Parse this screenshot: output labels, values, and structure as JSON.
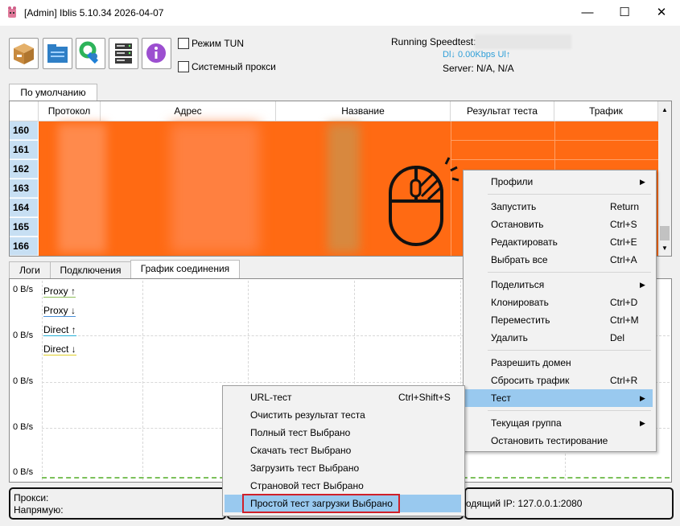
{
  "window": {
    "title": "[Admin] Iblis 5.10.34 2026-04-07",
    "minimize": "—",
    "maximize": "☐",
    "close": "✕"
  },
  "toolbar": {
    "buttons": [
      "box-icon",
      "folder-icon",
      "tools-icon",
      "server-icon",
      "info-icon"
    ],
    "tun_label": "Режим TUN",
    "proxy_label": "Системный прокси"
  },
  "speedtest": {
    "label": "Running Speedtest:",
    "rate": "Dl↓ 0.00Kbps Ul↑",
    "server": "Server: N/A, N/A"
  },
  "group_tab": "По умолчанию",
  "grid": {
    "columns": [
      "Протокол",
      "Адрес",
      "Название",
      "Результат теста",
      "Трафик"
    ],
    "rows": [
      "160",
      "161",
      "162",
      "163",
      "164",
      "165",
      "166"
    ],
    "row_color": "#ff6a13"
  },
  "bottom_tabs": [
    "Логи",
    "Подключения",
    "График соединения"
  ],
  "chart": {
    "y_labels": [
      "0 B/s",
      "0 B/s",
      "0 B/s",
      "0 B/s",
      "0 B/s"
    ],
    "legend": [
      {
        "name": "Proxy ↑",
        "color": "#8fbf5a"
      },
      {
        "name": "Proxy ↓",
        "color": "#4a90d9"
      },
      {
        "name": "Direct ↑",
        "color": "#25b0d8"
      },
      {
        "name": "Direct ↓",
        "color": "#e0cf2a"
      }
    ]
  },
  "status": {
    "proxy": "Прокси:",
    "direct": "Напрямую:",
    "ip": "ходящий IP: 127.0.0.1:2080"
  },
  "context_menu": {
    "items": [
      {
        "label": "Профили",
        "shortcut": "",
        "submenu": true
      },
      {
        "sep": true
      },
      {
        "label": "Запустить",
        "shortcut": "Return"
      },
      {
        "label": "Остановить",
        "shortcut": "Ctrl+S"
      },
      {
        "label": "Редактировать",
        "shortcut": "Ctrl+E"
      },
      {
        "label": "Выбрать все",
        "shortcut": "Ctrl+A"
      },
      {
        "sep": true
      },
      {
        "label": "Поделиться",
        "shortcut": "",
        "submenu": true
      },
      {
        "label": "Клонировать",
        "shortcut": "Ctrl+D"
      },
      {
        "label": "Переместить",
        "shortcut": "Ctrl+M"
      },
      {
        "label": "Удалить",
        "shortcut": "Del"
      },
      {
        "sep": true
      },
      {
        "label": "Разрешить домен",
        "shortcut": ""
      },
      {
        "label": "Сбросить трафик",
        "shortcut": "Ctrl+R"
      },
      {
        "label": "Тест",
        "shortcut": "",
        "submenu": true,
        "highlight": true
      },
      {
        "sep": true
      },
      {
        "label": "Текущая группа",
        "shortcut": "",
        "submenu": true
      },
      {
        "label": "Остановить тестирование",
        "shortcut": ""
      }
    ]
  },
  "test_submenu": {
    "items": [
      {
        "label": "URL-тест",
        "shortcut": "Ctrl+Shift+S"
      },
      {
        "label": "Очистить результат теста",
        "shortcut": ""
      },
      {
        "label": "Полный тест Выбрано",
        "shortcut": ""
      },
      {
        "label": "Скачать тест Выбрано",
        "shortcut": ""
      },
      {
        "label": "Загрузить тест Выбрано",
        "shortcut": ""
      },
      {
        "label": "Страновой тест Выбрано",
        "shortcut": ""
      },
      {
        "label": "Простой тест загрузки Выбрано",
        "shortcut": "",
        "highlight": true
      }
    ]
  }
}
